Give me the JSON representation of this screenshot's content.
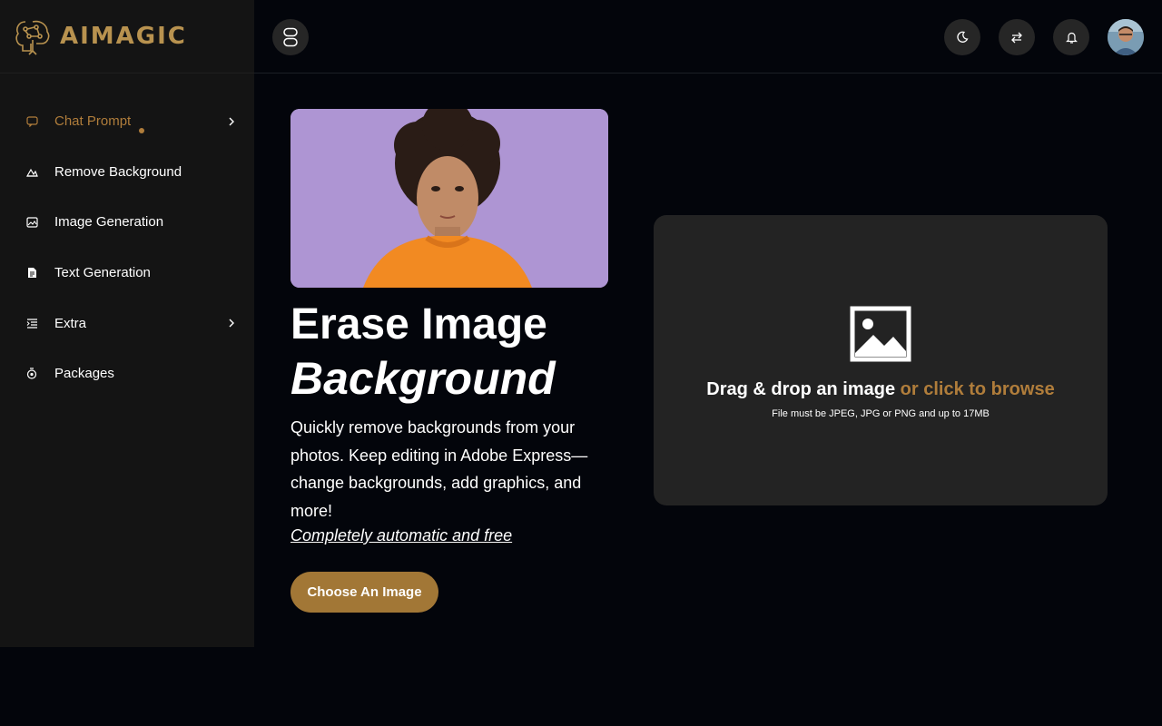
{
  "brand": {
    "name": "AIMAGIC",
    "accent": "#b07d3b"
  },
  "sidebar": {
    "items": [
      {
        "label": "Chat Prompt",
        "icon": "chat-icon",
        "active": true,
        "has_submenu": true
      },
      {
        "label": "Remove Background",
        "icon": "mountain-icon",
        "active": false,
        "has_submenu": false
      },
      {
        "label": "Image Generation",
        "icon": "image-icon",
        "active": false,
        "has_submenu": false
      },
      {
        "label": "Text Generation",
        "icon": "document-icon",
        "active": false,
        "has_submenu": false
      },
      {
        "label": "Extra",
        "icon": "indent-list-icon",
        "active": false,
        "has_submenu": true
      },
      {
        "label": "Packages",
        "icon": "stopwatch-icon",
        "active": false,
        "has_submenu": false
      }
    ]
  },
  "topbar": {
    "menu_toggle_icon": "sidebar-toggle-icon",
    "actions": [
      "moon-icon",
      "swap-icon",
      "bell-icon"
    ],
    "avatar": "user-avatar"
  },
  "hero": {
    "title_line1": "Erase Image",
    "title_line2": "Background",
    "description": "Quickly remove backgrounds from your photos. Keep editing in Adobe Express—change backgrounds, add graphics, and more!",
    "tagline": "Completely automatic and free",
    "button_label": "Choose An Image"
  },
  "dropzone": {
    "title": "Drag & drop an image",
    "browse": "or click to browse",
    "note": "File must be JPEG, JPG or PNG and up to 17MB",
    "icon": "image-placeholder-icon"
  }
}
